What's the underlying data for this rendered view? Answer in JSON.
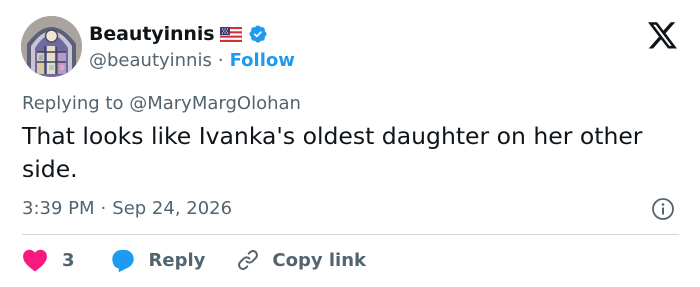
{
  "author": {
    "display_name": "Beautyinnis",
    "handle": "@beautyinnis",
    "follow_label": "Follow",
    "separator": "·",
    "flag_icon": "us-flag-icon",
    "verified_icon": "verified-badge-icon",
    "avatar_icon": "stained-glass-window-avatar"
  },
  "reply_context": {
    "prefix": "Replying to",
    "target_handle": "@MaryMargOlohan"
  },
  "tweet": {
    "text": "That looks like Ivanka's oldest daughter on her other side.",
    "time": "3:39 PM",
    "separator": "·",
    "date": "Sep 24, 2026"
  },
  "actions": {
    "like_count": "3",
    "reply_label": "Reply",
    "copy_link_label": "Copy link"
  },
  "colors": {
    "accent": "#1d9bf0",
    "like": "#f91880",
    "muted": "#536471",
    "text": "#0f1419"
  }
}
